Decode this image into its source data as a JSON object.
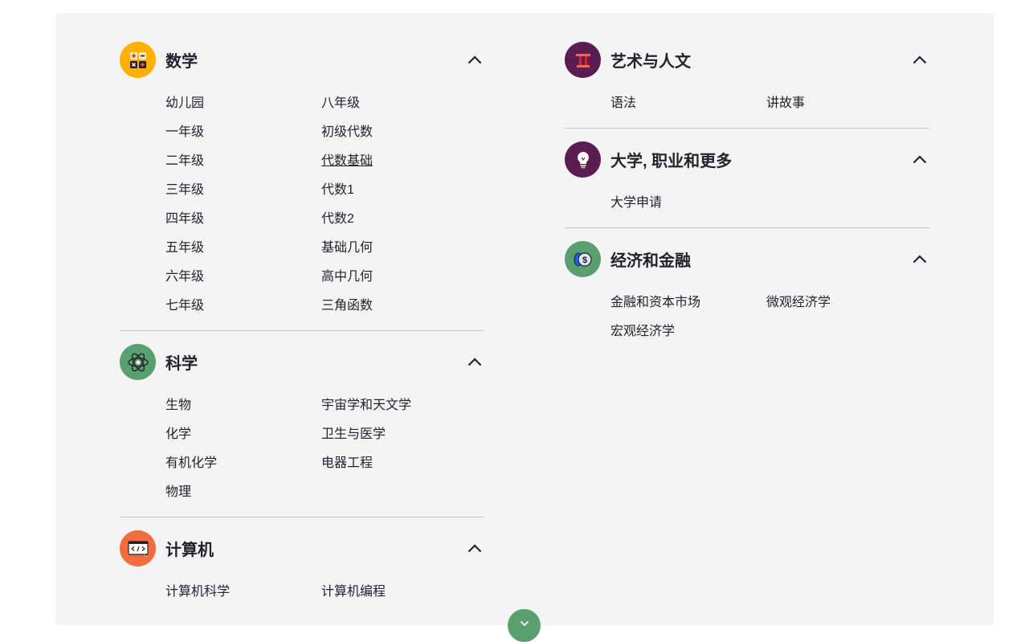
{
  "colors": {
    "panel_bg": "#f4f4f4",
    "math": "#ffb100",
    "arts": "#5a1e52",
    "college": "#5a1e52",
    "economics": "#5a9f6e",
    "science": "#5a9f6e",
    "computing": "#f26d3d",
    "expand_button": "#5a9f6e"
  },
  "sections": {
    "math": {
      "title": "数学",
      "icon": "calculator-icon",
      "links": [
        "幼儿园",
        "八年级",
        "一年级",
        "初级代数",
        "二年级",
        "代数基础",
        "三年级",
        "代数1",
        "四年级",
        "代数2",
        "五年级",
        "基础几何",
        "六年级",
        "高中几何",
        "七年级",
        "三角函数"
      ]
    },
    "science": {
      "title": "科学",
      "icon": "atom-icon",
      "links": [
        "生物",
        "宇宙学和天文学",
        "化学",
        "卫生与医学",
        "有机化学",
        "电器工程",
        "物理"
      ]
    },
    "computing": {
      "title": "计算机",
      "icon": "code-window-icon",
      "links": [
        "计算机科学",
        "计算机编程"
      ]
    },
    "arts": {
      "title": "艺术与人文",
      "icon": "column-icon",
      "links": [
        "语法",
        "讲故事"
      ]
    },
    "college": {
      "title": "大学, 职业和更多",
      "icon": "lightbulb-icon",
      "links": [
        "大学申请"
      ]
    },
    "economics": {
      "title": "经济和金融",
      "icon": "coins-icon",
      "links": [
        "金融和资本市场",
        "微观经济学",
        "宏观经济学"
      ]
    }
  },
  "hovered_link": "代数基础"
}
